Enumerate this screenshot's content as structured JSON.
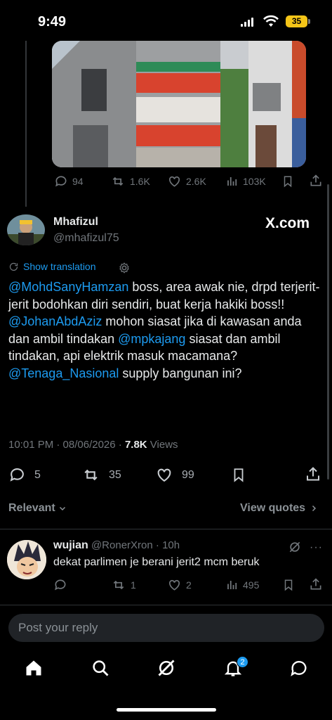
{
  "status_bar": {
    "time": "9:49",
    "battery": "35"
  },
  "colors": {
    "background": "#000000",
    "text": "#e7e9ea",
    "muted": "#71767b",
    "accent": "#1d9bf0",
    "battery": "#f5c518"
  },
  "parent_tweet": {
    "image_alt": "photo of a multi-storey building with red and green balconies",
    "stats": {
      "replies": "94",
      "reposts": "1.6K",
      "likes": "2.6K",
      "views": "103K"
    }
  },
  "main_tweet": {
    "author_name": "Mhafizul",
    "author_handle": "@mhafizul75",
    "source_logo": "X.com",
    "show_translation": "Show translation",
    "body": [
      {
        "text": "@MohdSanyHamzan",
        "mention": true
      },
      {
        "text": " boss, area awak nie, drpd terjerit-jerit bodohkan diri sendiri, buat kerja hakiki boss!! ",
        "mention": false
      },
      {
        "text": "@JohanAbdAziz",
        "mention": true
      },
      {
        "text": " mohon siasat jika di kawasan anda dan ambil tindakan ",
        "mention": false
      },
      {
        "text": "@mpkajang",
        "mention": true
      },
      {
        "text": " siasat dan ambil tindakan, api elektrik masuk macamana? ",
        "mention": false
      },
      {
        "text": "@Tenaga_Nasional",
        "mention": true
      },
      {
        "text": " supply bangunan ini?",
        "mention": false
      }
    ],
    "timestamp": "10:01 PM · 08/06/2026 · ",
    "views_count": "7.8K",
    "views_label": " Views",
    "stats": {
      "replies": "5",
      "reposts": "35",
      "likes": "99"
    }
  },
  "filter": {
    "relevant_label": "Relevant",
    "view_quotes_label": "View quotes"
  },
  "reply": {
    "author_name": "wujian",
    "author_handle": "@RonerXron",
    "time": "· 10h",
    "text": "dekat parlimen je berani jerit2 mcm beruk",
    "stats": {
      "replies": "",
      "reposts": "1",
      "likes": "2",
      "views": "495"
    }
  },
  "compose": {
    "placeholder": "Post your reply"
  },
  "tabbar": {
    "icons": [
      "home-icon",
      "search-icon",
      "grok-icon",
      "notifications-icon",
      "messages-icon"
    ],
    "notification_badge": "2"
  }
}
